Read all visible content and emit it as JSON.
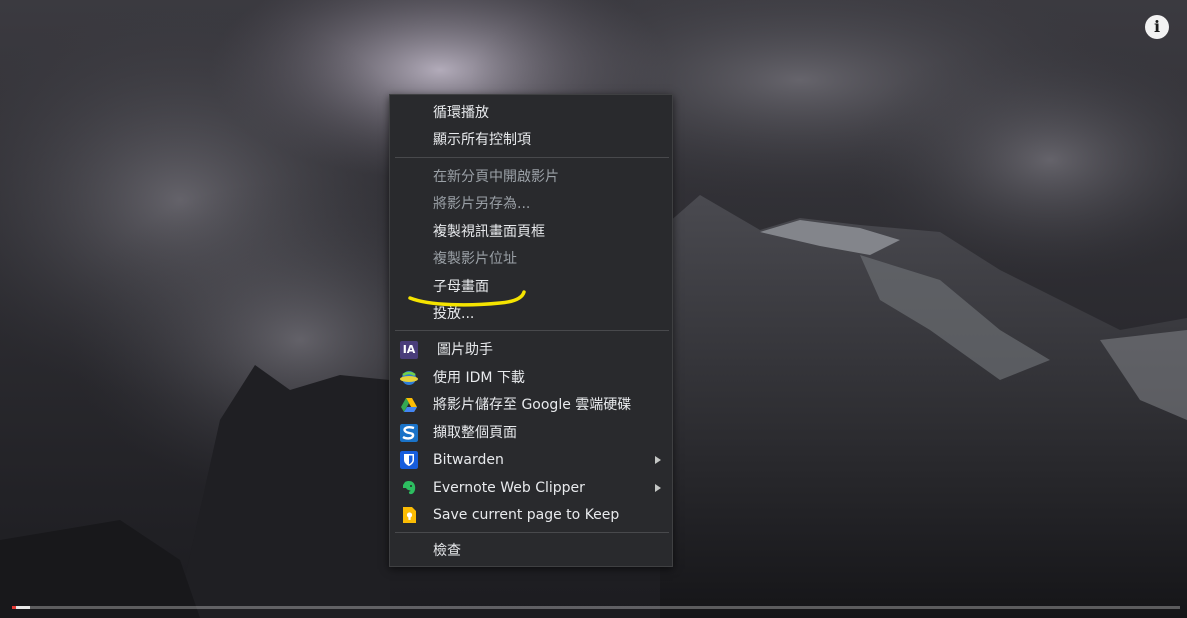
{
  "menu": {
    "loop": "循環播放",
    "show_controls": "顯示所有控制項",
    "open_in_new_tab": "在新分頁中開啟影片",
    "save_video_as": "將影片另存為...",
    "copy_video_frame": "複製視訊畫面頁框",
    "copy_video_address": "複製影片位址",
    "picture_in_picture": "子母畫面",
    "cast": "投放...",
    "image_assistant": "圖片助手",
    "idm_download": "使用 IDM 下載",
    "save_to_drive": "將影片儲存至 Google 雲端硬碟",
    "capture_page": "擷取整個頁面",
    "bitwarden": "Bitwarden",
    "evernote": "Evernote Web Clipper",
    "keep": "Save current page to Keep",
    "inspect": "檢查"
  },
  "icons": {
    "ia_text": "IA",
    "info": "i",
    "ia": "image-assistant-icon",
    "idm": "idm-icon",
    "drive": "google-drive-icon",
    "capture": "capture-s-icon",
    "bitwarden": "bitwarden-shield-icon",
    "evernote": "evernote-elephant-icon",
    "keep": "google-keep-icon"
  },
  "player": {
    "progress": 0.015
  },
  "colors": {
    "menu_bg": "#292a2d",
    "menu_text": "#e8eaed",
    "disabled_text": "#9aa0a6",
    "annotation": "#f5e400",
    "progress_red": "#e53935"
  }
}
